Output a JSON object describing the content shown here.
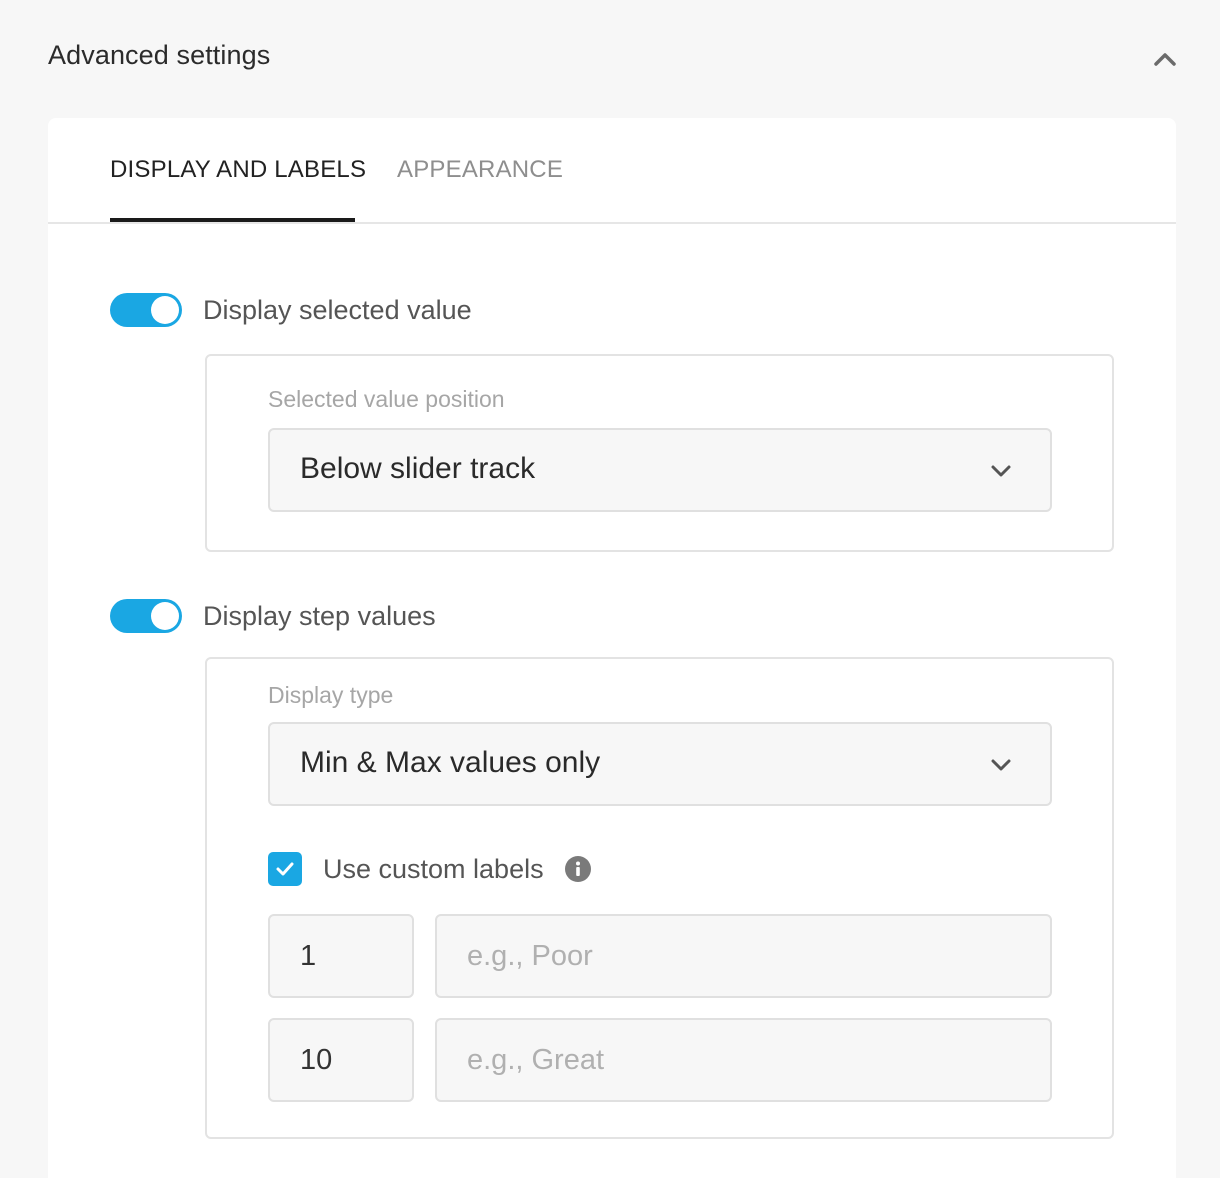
{
  "section": {
    "title": "Advanced settings",
    "collapse_icon": "chevron-up-icon"
  },
  "tabs": [
    {
      "label": "DISPLAY AND LABELS",
      "active": true
    },
    {
      "label": "APPEARANCE",
      "active": false
    }
  ],
  "display_selected_value": {
    "enabled": true,
    "label": "Display selected value",
    "position": {
      "label": "Selected value position",
      "value": "Below slider track",
      "icon": "chevron-down-icon"
    }
  },
  "display_step_values": {
    "enabled": true,
    "label": "Display step values",
    "display_type": {
      "label": "Display type",
      "value": "Min & Max values only",
      "icon": "chevron-down-icon"
    },
    "custom_labels": {
      "checked": true,
      "label": "Use custom labels",
      "info_icon": "info-icon",
      "rows": [
        {
          "value": "1",
          "label_value": "",
          "label_placeholder": "e.g., Poor"
        },
        {
          "value": "10",
          "label_value": "",
          "label_placeholder": "e.g., Great"
        }
      ]
    }
  },
  "colors": {
    "accent": "#1aa7e3",
    "background": "#f7f7f7",
    "card": "#ffffff",
    "tab_active_underline": "#1a1a1a"
  }
}
